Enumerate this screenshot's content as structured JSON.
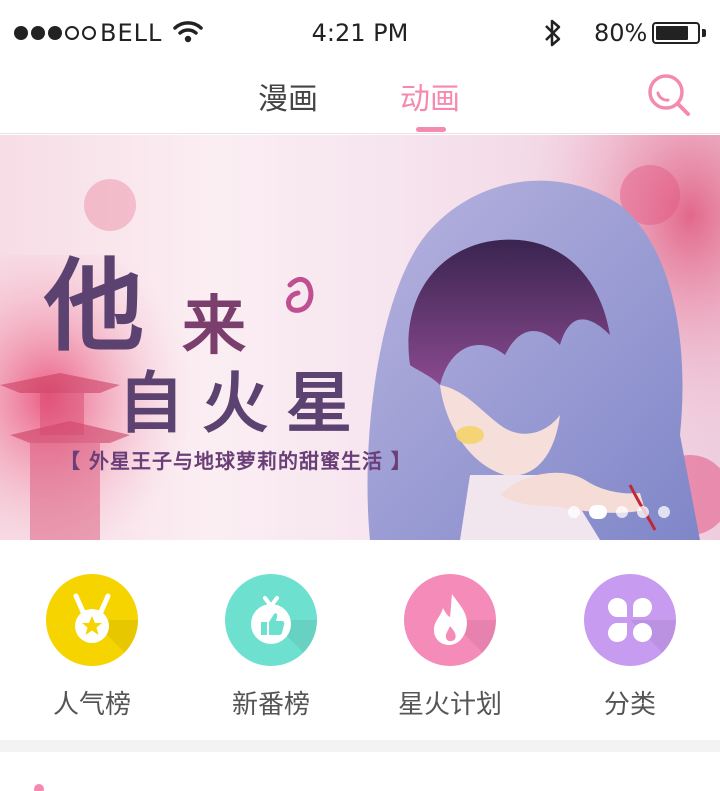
{
  "status_bar": {
    "carrier": "BELL",
    "time": "4:21 PM",
    "battery_percent": "80%",
    "battery_level": 0.8,
    "signal_bars": 3,
    "icons": [
      "wifi-icon",
      "bluetooth-icon",
      "battery-icon"
    ]
  },
  "nav": {
    "tabs": [
      {
        "label": "漫画",
        "active": false
      },
      {
        "label": "动画",
        "active": true
      }
    ],
    "search_icon": "search-icon",
    "accent": "#f48ab0"
  },
  "banner": {
    "title_line1": "他",
    "title_line1b": "来",
    "title_line2": "自火星",
    "subtitle": "【 外星王子与地球萝莉的甜蜜生活 】",
    "slide_count": 5,
    "active_slide": 1
  },
  "categories": [
    {
      "label": "人气榜",
      "icon": "medal-icon",
      "color": "#f5d400"
    },
    {
      "label": "新番榜",
      "icon": "thumbs-up-icon",
      "color": "#6ee0cf"
    },
    {
      "label": "星火计划",
      "icon": "flame-icon",
      "color": "#f58bb8"
    },
    {
      "label": "分类",
      "icon": "grid-icon",
      "color": "#c79cf0"
    }
  ]
}
